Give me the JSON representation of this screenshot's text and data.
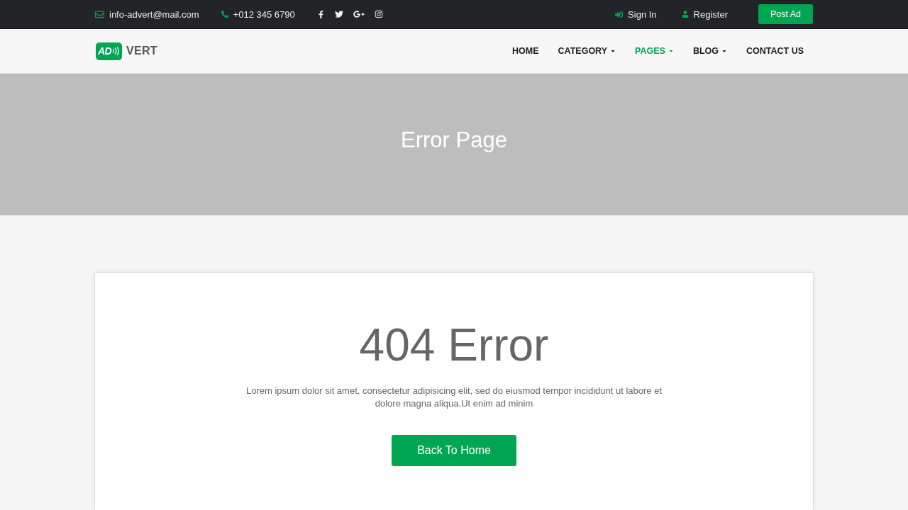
{
  "top_bar": {
    "email": "info-advert@mail.com",
    "phone": "+012 345 6790",
    "links": [
      {
        "kind": "signin",
        "label": "Sign In"
      },
      {
        "kind": "register",
        "label": "Register"
      }
    ],
    "post_button": "Post Ad"
  },
  "nav": {
    "logo": {
      "mark": "AD",
      "text": "VERT"
    },
    "items": [
      {
        "label": "HOME",
        "selected": false,
        "dropdown": false
      },
      {
        "label": "CATEGORY",
        "selected": false,
        "dropdown": true
      },
      {
        "label": "PAGES",
        "selected": true,
        "dropdown": true
      },
      {
        "label": "BLOG",
        "selected": false,
        "dropdown": true
      },
      {
        "label": "CONTACT US",
        "selected": false,
        "dropdown": false
      }
    ]
  },
  "banner": {
    "title": "Error Page"
  },
  "error_card": {
    "heading": "404 Error",
    "message": "Lorem ipsum dolor sit amet, consectetur adipisicing elit, sed do eiusmod tempor incididunt ut labore et dolore magna aliqua.Ut enim ad minim",
    "button": "Back To Home"
  }
}
